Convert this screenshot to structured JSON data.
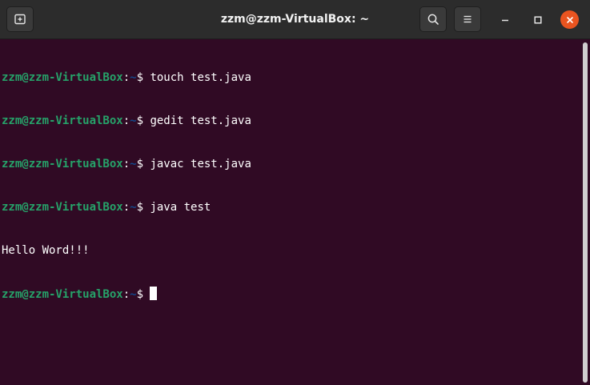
{
  "window": {
    "title": "zzm@zzm-VirtualBox: ~"
  },
  "titlebar": {
    "icons": [
      "new-tab-icon",
      "search-icon",
      "hamburger-menu-icon",
      "minimize-icon",
      "maximize-icon",
      "close-icon"
    ],
    "close_color": "#e95420"
  },
  "terminal": {
    "background": "#300a24",
    "prompt_user": "zzm@zzm-VirtualBox",
    "prompt_path": "~",
    "lines": [
      {
        "user": "zzm@zzm-VirtualBox",
        "colon": ":",
        "path": "~",
        "dollar": "$ ",
        "cmd": "touch test.java"
      },
      {
        "user": "zzm@zzm-VirtualBox",
        "colon": ":",
        "path": "~",
        "dollar": "$ ",
        "cmd": "gedit test.java"
      },
      {
        "user": "zzm@zzm-VirtualBox",
        "colon": ":",
        "path": "~",
        "dollar": "$ ",
        "cmd": "javac test.java"
      },
      {
        "user": "zzm@zzm-VirtualBox",
        "colon": ":",
        "path": "~",
        "dollar": "$ ",
        "cmd": "java test"
      }
    ],
    "output": "Hello Word!!!",
    "current_prompt": {
      "user": "zzm@zzm-VirtualBox",
      "colon": ":",
      "path": "~",
      "dollar": "$ "
    }
  }
}
